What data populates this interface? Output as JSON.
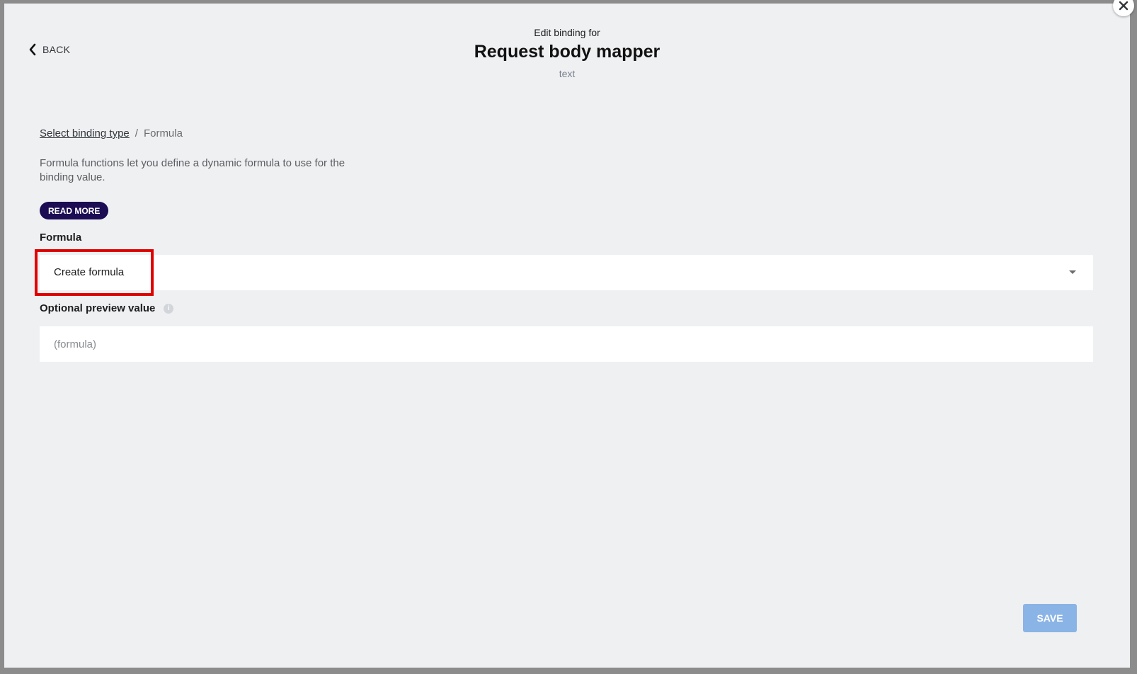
{
  "dialog": {
    "back_label": "BACK",
    "subtitle": "Edit binding for",
    "title": "Request body mapper",
    "type_label": "text"
  },
  "breadcrumb": {
    "link": "Select binding type",
    "separator": "/",
    "current": "Formula"
  },
  "description": "Formula functions let you define a dynamic formula to use for the binding value.",
  "read_more_label": "READ MORE",
  "formula": {
    "label": "Formula",
    "selected_value": "Create formula"
  },
  "preview": {
    "label": "Optional preview value",
    "placeholder": "(formula)"
  },
  "save_label": "SAVE",
  "colors": {
    "dialog_bg": "#eff0f2",
    "read_more_bg": "#1b0c54",
    "save_bg": "#8bb4e6",
    "highlight": "#e00000"
  },
  "icons": {
    "back": "chevron-left-icon",
    "close": "close-icon",
    "dropdown": "caret-down-icon",
    "info": "info-icon"
  }
}
